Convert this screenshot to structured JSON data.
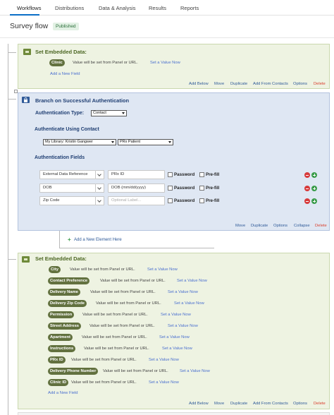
{
  "nav": {
    "tabs": [
      "Workflows",
      "Distributions",
      "Data & Analysis",
      "Results",
      "Reports"
    ]
  },
  "page": {
    "title": "Survey flow",
    "status": "Published"
  },
  "block1": {
    "title": "Set Embedded Data:",
    "fields": [
      {
        "name": "Clinic",
        "value_text": "Value will be set from Panel or URL.",
        "link": "Set a Value Now"
      }
    ],
    "add_field": "Add a New Field",
    "actions": [
      "Add Below",
      "Move",
      "Duplicate",
      "Add From Contacts",
      "Options",
      "Delete"
    ]
  },
  "auth": {
    "title": "Branch on Successful Authentication",
    "type_label": "Authentication Type:",
    "type_value": "Contact",
    "using_label": "Authenticate Using Contact",
    "library_value": "My Library: Kristin Gangwer",
    "list_value": "PRx Patient",
    "fields_label": "Authentication Fields",
    "rows": [
      {
        "field": "External Data Reference",
        "input": "PRx ID",
        "placeholder": false
      },
      {
        "field": "DOB",
        "input": "DOB (mm/dd/yyyy)",
        "placeholder": false
      },
      {
        "field": "Zip Code",
        "input": "Optional Label...",
        "placeholder": true
      }
    ],
    "password_label": "Password",
    "prefill_label": "Pre-fill",
    "actions": [
      "Move",
      "Duplicate",
      "Options",
      "Collapse",
      "Delete"
    ]
  },
  "add_element": "Add a New Element Here",
  "block2": {
    "title": "Set Embedded Data:",
    "value_text": "Value will be set from Panel or URL.",
    "link": "Set a Value Now",
    "fields": [
      "City",
      "Contact Preference",
      "Delivery Name",
      "Delivery Zip Code",
      "Permission",
      "Street Address",
      "Apartment",
      "Instructions",
      "PRx ID",
      "Delivery Phone Number",
      "Clinic ID"
    ],
    "add_field": "Add a New Field",
    "actions": [
      "Add Below",
      "Move",
      "Duplicate",
      "Add From Contacts",
      "Options",
      "Delete"
    ]
  },
  "colors": {
    "accent": "#0b6fc7",
    "embedded_bg": "#eef3e2",
    "auth_bg": "#dfe7f3",
    "pill": "#62713f",
    "delete": "#d9402f"
  }
}
